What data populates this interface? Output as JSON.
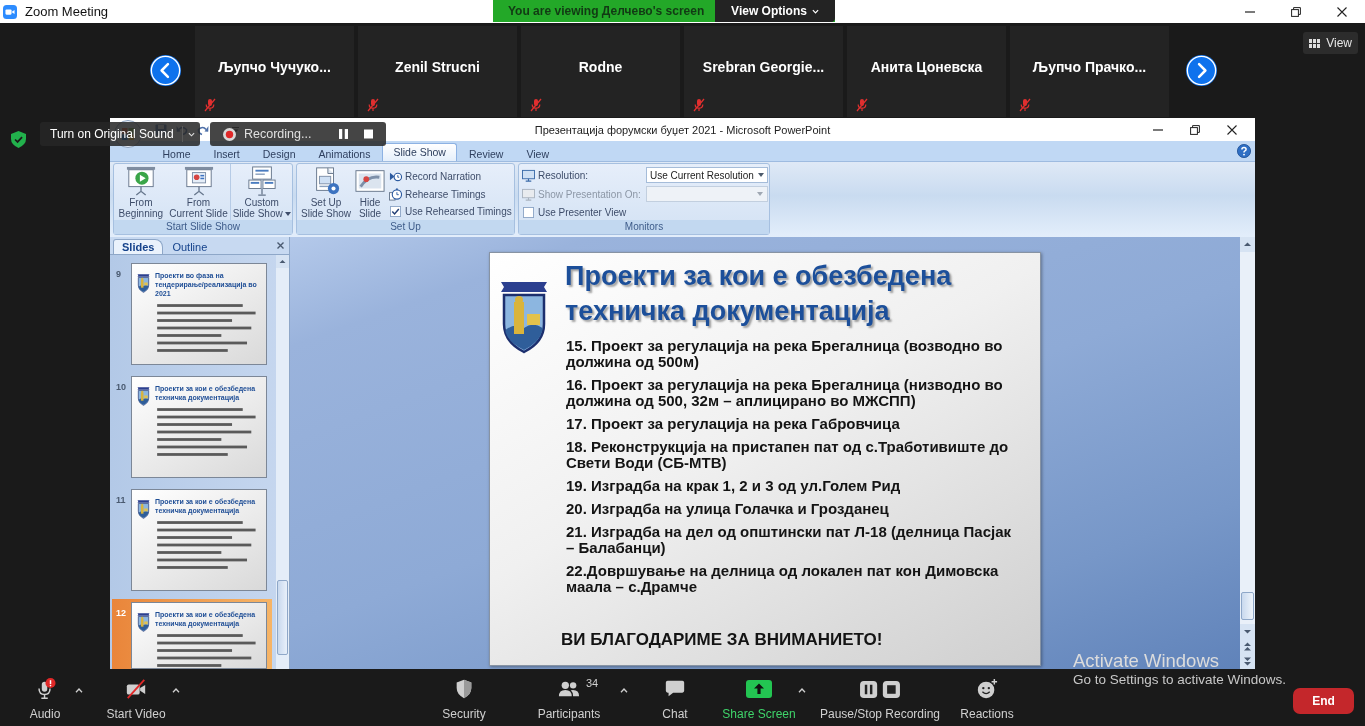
{
  "app_title": "Zoom Meeting",
  "share_banner": {
    "message": "You are viewing Делчево's screen",
    "options_label": "View Options"
  },
  "gallery": {
    "participants": [
      {
        "name": "Љупчо Чучуко...",
        "muted": true
      },
      {
        "name": "Zenil Strucni",
        "muted": true
      },
      {
        "name": "Rodne",
        "muted": true
      },
      {
        "name": "Srebran Georgie...",
        "muted": true
      },
      {
        "name": "Анита Цоневска",
        "muted": true
      },
      {
        "name": "Љупчо Прачко...",
        "muted": true
      }
    ],
    "view_label": "View"
  },
  "meeting_overlay": {
    "original_sound_label": "Turn on Original Sound",
    "recording_label": "Recording..."
  },
  "powerpoint": {
    "title": "Презентација форумски буџет 2021 - Microsoft PowerPoint",
    "tabs": [
      {
        "label": "Home",
        "selected": false
      },
      {
        "label": "Insert",
        "selected": false
      },
      {
        "label": "Design",
        "selected": false
      },
      {
        "label": "Animations",
        "selected": false
      },
      {
        "label": "Slide Show",
        "selected": true
      },
      {
        "label": "Review",
        "selected": false
      },
      {
        "label": "View",
        "selected": false
      }
    ],
    "ribbon_groups": [
      {
        "label": "Start Slide Show",
        "items": [
          {
            "kind": "large",
            "label": "From\nBeginning"
          },
          {
            "kind": "large",
            "label": "From\nCurrent Slide"
          },
          {
            "kind": "large_menu",
            "label": "Custom\nSlide Show"
          }
        ]
      },
      {
        "label": "Set Up",
        "items": [
          {
            "kind": "large",
            "label": "Set Up\nSlide Show"
          },
          {
            "kind": "large",
            "label": "Hide\nSlide"
          },
          {
            "kind": "small",
            "label": "Record Narration"
          },
          {
            "kind": "small",
            "label": "Rehearse Timings"
          },
          {
            "kind": "checkbox",
            "label": "Use Rehearsed Timings",
            "checked": true
          }
        ]
      },
      {
        "label": "Monitors",
        "items": [
          {
            "kind": "dropdown",
            "label": "Resolution:",
            "value": "Use Current Resolution",
            "disabled": false
          },
          {
            "kind": "dropdown",
            "label": "Show Presentation On:",
            "disabled": true
          },
          {
            "kind": "checkbox",
            "label": "Use Presenter View",
            "checked": false
          }
        ]
      }
    ],
    "pane_tabs": [
      {
        "label": "Slides",
        "selected": true
      },
      {
        "label": "Outline",
        "selected": false
      }
    ],
    "thumbnails": [
      {
        "number": "9",
        "title": "Проекти во фаза на тендерирање/реализација во 2021",
        "selected": false
      },
      {
        "number": "10",
        "title": "Проекти за кои е обезбедена техничка документација",
        "selected": false
      },
      {
        "number": "11",
        "title": "Проекти за кои е обезбедена техничка документација",
        "selected": false
      },
      {
        "number": "12",
        "title": "Проекти за кои е обезбедена техничка документација",
        "selected": true
      }
    ],
    "slide": {
      "title": "Проекти за кои е обезбедена техничка документација",
      "items": [
        "15. Проект за регулација на река Брегалница (возводно во должина од 500м)",
        "16. Проект за регулација на река Брегалница (низводно во должина од 500, 32м – аплицирано во МЖСПП)",
        "17. Проект за регулација на река Габровчица",
        "18. Реконструкција на пристапен пат од с.Тработивиште до Свети Води (СБ-МТВ)",
        "19. Изградба на крак 1, 2 и 3 од ул.Голем Рид",
        "20. Изградба на улица Голачка и Грозданец",
        "21. Изградба на дел од општински пат Л-18 (делница Пасјак – Балабанци)",
        "22.Довршување на делница од локален пат кон Димовска маала – с.Драмче"
      ],
      "closing": "ВИ БЛАГОДАРИМЕ ЗА ВНИМАНИЕТО!"
    }
  },
  "toolbar": {
    "items": [
      {
        "kind": "audio",
        "label": "Audio",
        "alert": true,
        "menu": true
      },
      {
        "kind": "video",
        "label": "Start Video",
        "off": true,
        "menu": true
      },
      {
        "kind": "security",
        "label": "Security",
        "menu": false
      },
      {
        "kind": "participants",
        "label": "Participants",
        "count": "34",
        "menu": true
      },
      {
        "kind": "chat",
        "label": "Chat",
        "menu": false
      },
      {
        "kind": "share",
        "label": "Share Screen",
        "menu": true
      },
      {
        "kind": "record",
        "label": "Pause/Stop Recording",
        "menu": false
      },
      {
        "kind": "reactions",
        "label": "Reactions",
        "menu": false
      }
    ],
    "end_label": "End"
  },
  "activation_notice": {
    "title": "Activate Windows",
    "message": "Go to Settings to activate Windows."
  }
}
